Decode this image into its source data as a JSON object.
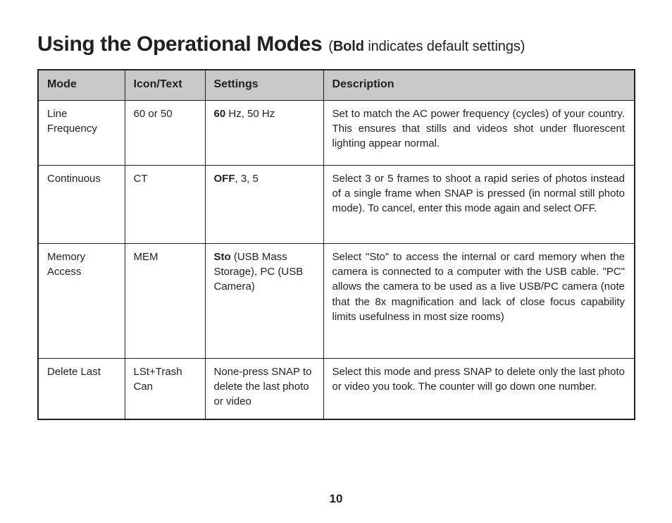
{
  "title": {
    "heading": "Using the Operational Modes",
    "note_open": "(",
    "note_bold": "Bold",
    "note_rest": " indicates default settings)"
  },
  "table": {
    "columns": [
      "Mode",
      "Icon/Text",
      "Settings",
      "Description"
    ],
    "rows": [
      {
        "mode": "Line Frequency",
        "icon_text": "60 or 50",
        "settings_bold": "60",
        "settings_rest": " Hz, 50 Hz",
        "description": "Set to match the AC power frequency (cycles) of your country. This ensures that stills and videos shot under fluorescent lighting appear normal."
      },
      {
        "mode": "Continuous",
        "icon_text": "CT",
        "settings_bold": "OFF",
        "settings_rest": ", 3, 5",
        "description": "Select 3 or 5 frames to shoot a rapid series of photos instead of a single frame when SNAP is pressed (in normal still photo mode). To cancel, enter this mode again and select OFF."
      },
      {
        "mode": "Memory Access",
        "icon_text": "MEM",
        "settings_bold": "Sto",
        "settings_rest": " (USB Mass Storage), PC (USB Camera)",
        "description": "Select \"Sto\" to access the internal or card memory when the camera is connected to a computer with the USB cable. \"PC\" allows the camera to be used as a live USB/PC camera (note that the 8x magnification and lack of close focus capability limits usefulness in most size rooms)"
      },
      {
        "mode": "Delete Last",
        "icon_text": "LSt+Trash Can",
        "settings_bold": "",
        "settings_rest": "None-press SNAP to delete the last photo or video",
        "description": "Select this mode and press SNAP to delete only the last photo or video you took. The counter will go down one number."
      }
    ]
  },
  "footer": {
    "page_number": "10"
  }
}
